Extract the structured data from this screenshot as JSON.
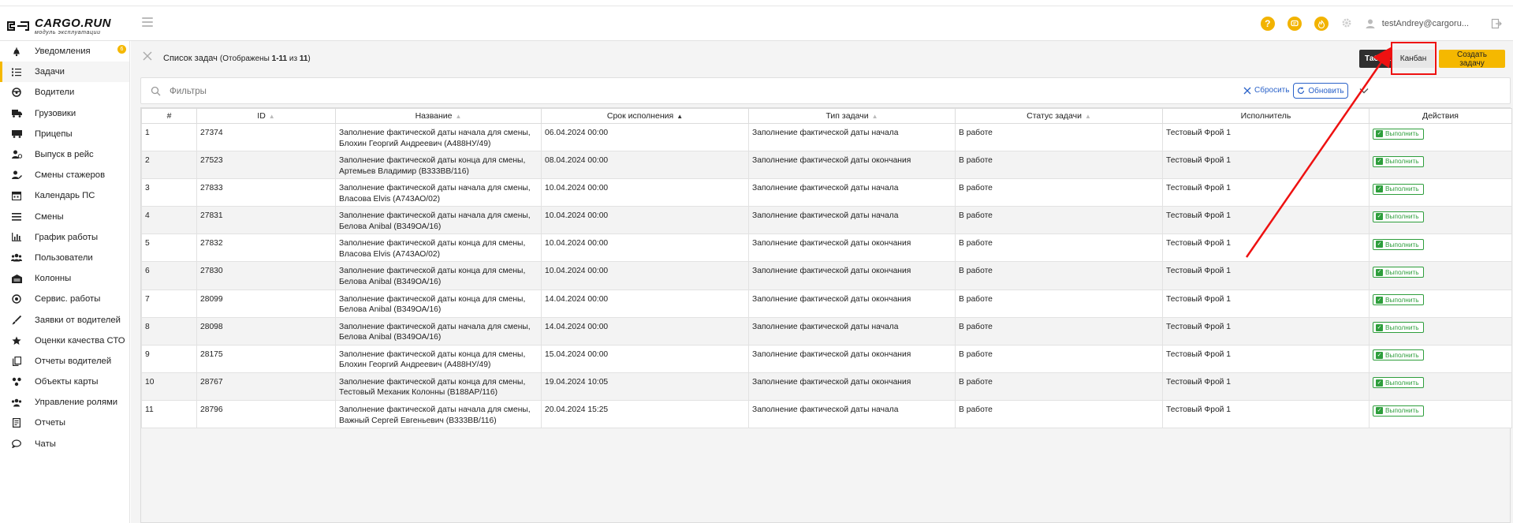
{
  "app": {
    "logo_name": "CARGO.RUN",
    "logo_sub": "модуль эксплуатации",
    "user_email": "testAndrey@cargoru..."
  },
  "colors": {
    "accent": "#f5b800",
    "link": "#2a62c9",
    "success": "#2e9e3c",
    "annotation": "#e11111"
  },
  "topbar": {
    "icons": [
      "help-icon",
      "chat-icon",
      "fire-icon",
      "gear-icon",
      "user-icon",
      "logout-icon"
    ]
  },
  "sidebar": {
    "items": [
      {
        "label": "Уведомления",
        "icon": "bell-icon",
        "badge": "6"
      },
      {
        "label": "Задачи",
        "icon": "tasks-icon",
        "active": true
      },
      {
        "label": "Водители",
        "icon": "steering-wheel-icon"
      },
      {
        "label": "Грузовики",
        "icon": "truck-icon"
      },
      {
        "label": "Прицепы",
        "icon": "trailer-icon"
      },
      {
        "label": "Выпуск в рейс",
        "icon": "user-dispatch-icon"
      },
      {
        "label": "Смены стажеров",
        "icon": "user-edit-icon"
      },
      {
        "label": "Календарь ПС",
        "icon": "calendar-icon"
      },
      {
        "label": "Смены",
        "icon": "list-icon"
      },
      {
        "label": "График работы",
        "icon": "chart-icon"
      },
      {
        "label": "Пользователи",
        "icon": "users-icon"
      },
      {
        "label": "Колонны",
        "icon": "garage-icon"
      },
      {
        "label": "Сервис. работы",
        "icon": "service-icon"
      },
      {
        "label": "Заявки от водителей",
        "icon": "brush-icon"
      },
      {
        "label": "Оценки качества СТО",
        "icon": "star-icon"
      },
      {
        "label": "Отчеты водителей",
        "icon": "copy-icon"
      },
      {
        "label": "Объекты карты",
        "icon": "map-objects-icon"
      },
      {
        "label": "Управление ролями",
        "icon": "roles-icon"
      },
      {
        "label": "Отчеты",
        "icon": "report-icon"
      },
      {
        "label": "Чаты",
        "icon": "comment-icon"
      }
    ]
  },
  "header": {
    "title": "Список задач",
    "shown_prefix": "(Отображены ",
    "shown_range": "1-11",
    "shown_of": " из ",
    "shown_total": "11",
    "shown_suffix": ")",
    "btn_table": "Таблица",
    "btn_kanban": "Канбан",
    "btn_create": "Создать задачу"
  },
  "filters": {
    "placeholder": "Фильтры",
    "reset_label": "Сбросить",
    "refresh_label": "Обновить"
  },
  "table": {
    "columns": [
      {
        "label": "#",
        "sort": "none"
      },
      {
        "label": "ID",
        "sort": "both"
      },
      {
        "label": "Название",
        "sort": "both"
      },
      {
        "label": "Срок исполнения",
        "sort": "asc"
      },
      {
        "label": "Тип задачи",
        "sort": "both"
      },
      {
        "label": "Статус задачи",
        "sort": "both"
      },
      {
        "label": "Исполнитель",
        "sort": "none"
      },
      {
        "label": "Действия",
        "sort": "none"
      }
    ],
    "action_label": "Выполнить",
    "rows": [
      {
        "n": "1",
        "id": "27374",
        "name_1": "Заполнение фактической даты начала для смены,",
        "name_2": "Блохин Георгий Андреевич (А488НУ/49)",
        "due": "06.04.2024 00:00",
        "type": "Заполнение фактической даты начала",
        "status": "В работе",
        "assignee": "Тестовый Фрой 1"
      },
      {
        "n": "2",
        "id": "27523",
        "name_1": "Заполнение фактической даты конца для смены,",
        "name_2": "Артемьев Владимир (В333ВВ/116)",
        "due": "08.04.2024 00:00",
        "type": "Заполнение фактической даты окончания",
        "status": "В работе",
        "assignee": "Тестовый Фрой 1"
      },
      {
        "n": "3",
        "id": "27833",
        "name_1": "Заполнение фактической даты начала для смены,",
        "name_2": "Власова Elvis (А743АО/02)",
        "due": "10.04.2024 00:00",
        "type": "Заполнение фактической даты начала",
        "status": "В работе",
        "assignee": "Тестовый Фрой 1"
      },
      {
        "n": "4",
        "id": "27831",
        "name_1": "Заполнение фактической даты начала для смены,",
        "name_2": "Белова Anibal (В349ОА/16)",
        "due": "10.04.2024 00:00",
        "type": "Заполнение фактической даты начала",
        "status": "В работе",
        "assignee": "Тестовый Фрой 1"
      },
      {
        "n": "5",
        "id": "27832",
        "name_1": "Заполнение фактической даты конца для смены,",
        "name_2": "Власова Elvis (А743АО/02)",
        "due": "10.04.2024 00:00",
        "type": "Заполнение фактической даты окончания",
        "status": "В работе",
        "assignee": "Тестовый Фрой 1"
      },
      {
        "n": "6",
        "id": "27830",
        "name_1": "Заполнение фактической даты конца для смены,",
        "name_2": "Белова Anibal (В349ОА/16)",
        "due": "10.04.2024 00:00",
        "type": "Заполнение фактической даты окончания",
        "status": "В работе",
        "assignee": "Тестовый Фрой 1"
      },
      {
        "n": "7",
        "id": "28099",
        "name_1": "Заполнение фактической даты конца для смены,",
        "name_2": "Белова Anibal (В349ОА/16)",
        "due": "14.04.2024 00:00",
        "type": "Заполнение фактической даты окончания",
        "status": "В работе",
        "assignee": "Тестовый Фрой 1"
      },
      {
        "n": "8",
        "id": "28098",
        "name_1": "Заполнение фактической даты начала для смены,",
        "name_2": "Белова Anibal (В349ОА/16)",
        "due": "14.04.2024 00:00",
        "type": "Заполнение фактической даты начала",
        "status": "В работе",
        "assignee": "Тестовый Фрой 1"
      },
      {
        "n": "9",
        "id": "28175",
        "name_1": "Заполнение фактической даты конца для смены,",
        "name_2": "Блохин Георгий Андреевич (А488НУ/49)",
        "due": "15.04.2024 00:00",
        "type": "Заполнение фактической даты окончания",
        "status": "В работе",
        "assignee": "Тестовый Фрой 1"
      },
      {
        "n": "10",
        "id": "28767",
        "name_1": "Заполнение фактической даты конца для смены,",
        "name_2": "Тестовый Механик Колонны (В188АР/116)",
        "due": "19.04.2024 10:05",
        "type": "Заполнение фактической даты окончания",
        "status": "В работе",
        "assignee": "Тестовый Фрой 1"
      },
      {
        "n": "11",
        "id": "28796",
        "name_1": "Заполнение фактической даты начала для смены,",
        "name_2": "Важный Сергей Евгеньевич (В333ВВ/116)",
        "due": "20.04.2024 15:25",
        "type": "Заполнение фактической даты начала",
        "status": "В работе",
        "assignee": "Тестовый Фрой 1"
      }
    ]
  }
}
